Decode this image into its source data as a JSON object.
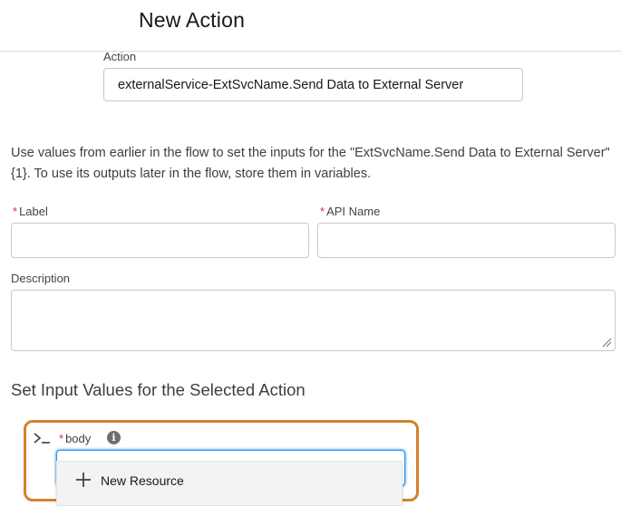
{
  "header": {
    "title": "New Action"
  },
  "action": {
    "label": "Action",
    "value": "externalService-ExtSvcName.Send Data to External Server"
  },
  "instructions": "Use values from earlier in the flow to set the inputs for the \"ExtSvcName.Send Data to External Server\" {1}. To use its outputs later in the flow, store them in variables.",
  "fields": {
    "label_label": "Label",
    "api_name_label": "API Name",
    "description_label": "Description",
    "required_marker": "*"
  },
  "section_title": "Set Input Values for the Selected Action",
  "body_param": {
    "label": "body",
    "info_glyph": "i",
    "value": ""
  },
  "dropdown": {
    "items": [
      {
        "label": "New Resource",
        "icon": "plus-icon"
      }
    ]
  },
  "colors": {
    "highlight": "#d3822b",
    "required": "#c23934",
    "focus": "#1b96ff"
  }
}
